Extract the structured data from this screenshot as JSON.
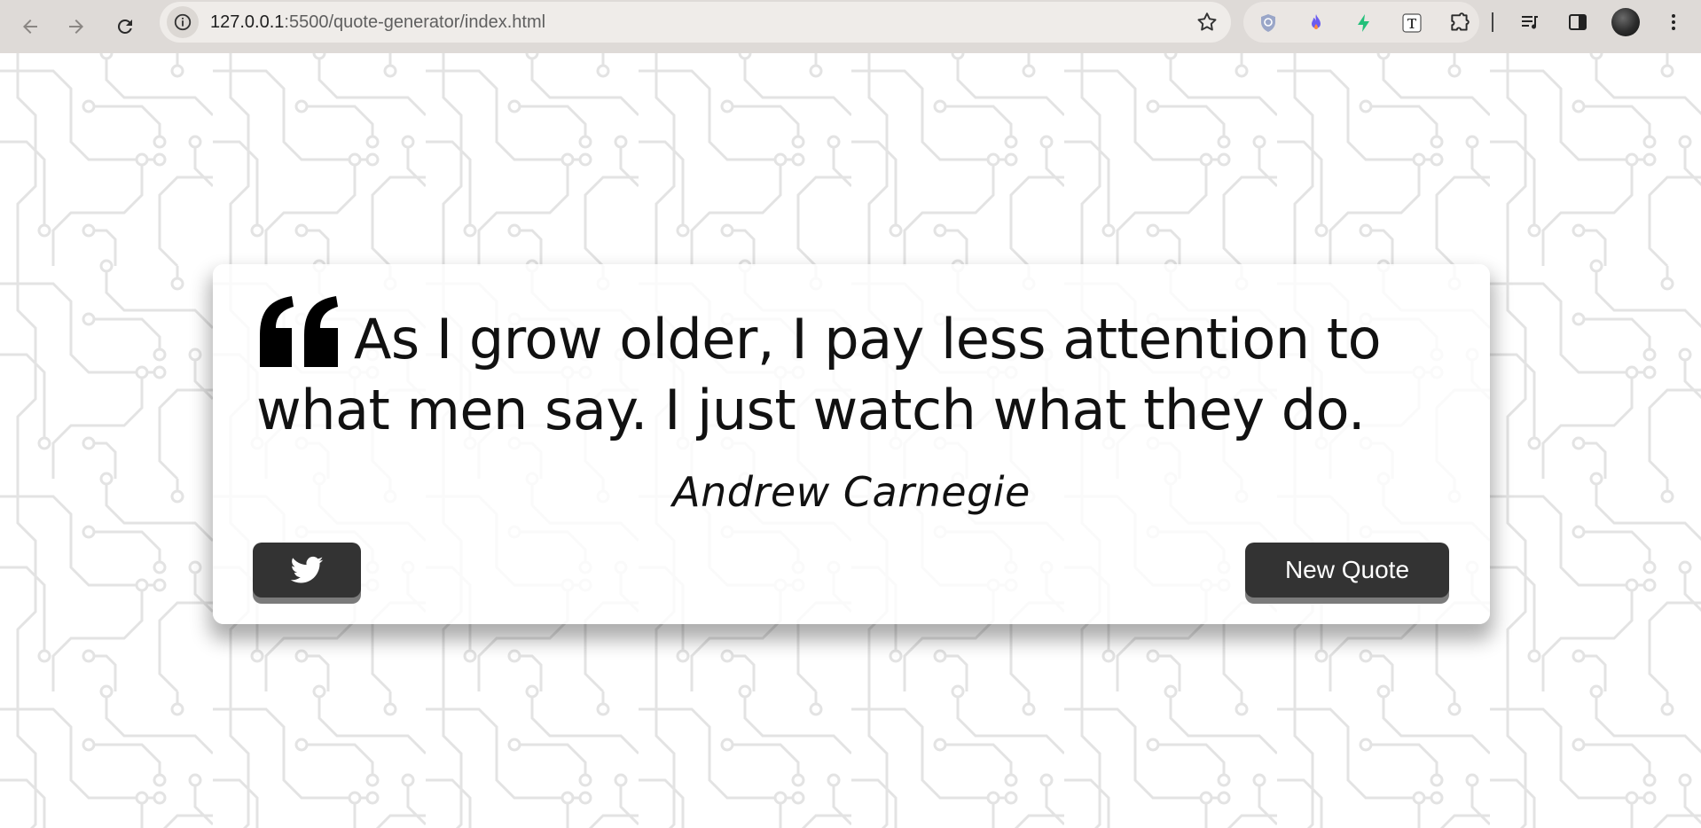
{
  "browser": {
    "url_host": "127.0.0.1",
    "url_path": ":5500/quote-generator/index.html",
    "icons": [
      "back-arrow-icon",
      "forward-arrow-icon",
      "reload-icon",
      "site-info-icon",
      "bookmark-star-icon",
      "shield-extension-icon",
      "flame-extension-icon",
      "bolt-extension-icon",
      "text-extension-icon",
      "puzzle-extensions-icon",
      "media-controls-icon",
      "side-panel-icon",
      "profile-avatar",
      "menu-dots-icon"
    ]
  },
  "quote": {
    "text": "As I grow older, I pay less attention to what men say. I just watch what they do.",
    "author": "Andrew Carnegie"
  },
  "buttons": {
    "new_quote_label": "New Quote",
    "twitter_icon": "twitter-icon"
  },
  "colors": {
    "button_bg": "#333333",
    "button_shadow": "#7b7b7b",
    "pattern_line": "#e4e4e4",
    "chrome_bg": "#dedad7"
  }
}
